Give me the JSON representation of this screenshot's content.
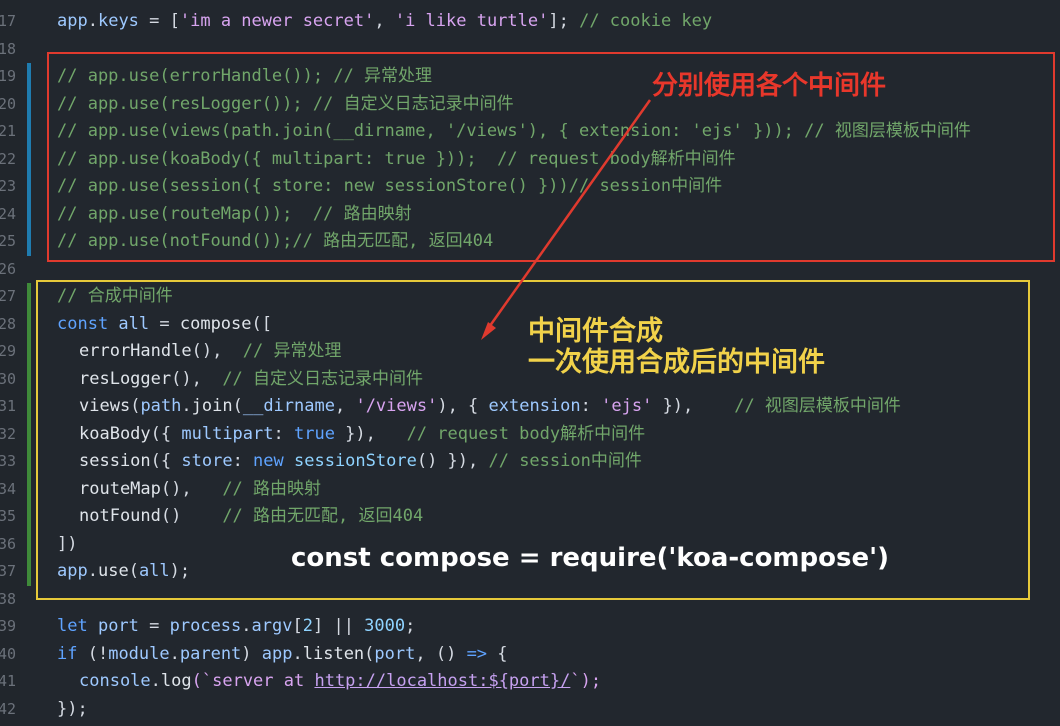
{
  "editor": {
    "lines": [
      {
        "num": "17",
        "tokens": [
          {
            "t": "app",
            "c": "v"
          },
          {
            "t": ".",
            "c": "p"
          },
          {
            "t": "keys",
            "c": "v"
          },
          {
            "t": " = [",
            "c": "p"
          },
          {
            "t": "'im a newer secret'",
            "c": "s"
          },
          {
            "t": ", ",
            "c": "p"
          },
          {
            "t": "'i like turtle'",
            "c": "s"
          },
          {
            "t": "]; ",
            "c": "p"
          },
          {
            "t": "// cookie key",
            "c": "c"
          }
        ]
      },
      {
        "num": "18",
        "tokens": []
      },
      {
        "num": "19",
        "mark": "blue",
        "tokens": [
          {
            "t": "// app.use(errorHandle()); // 异常处理",
            "c": "c"
          }
        ]
      },
      {
        "num": "20",
        "mark": "blue",
        "tokens": [
          {
            "t": "// app.use(resLogger()); // 自定义日志记录中间件",
            "c": "c"
          }
        ]
      },
      {
        "num": "21",
        "mark": "blue",
        "tokens": [
          {
            "t": "// app.use(views(path.join(__dirname, '/views'), { extension: 'ejs' })); // 视图层模板中间件",
            "c": "c"
          }
        ]
      },
      {
        "num": "22",
        "mark": "blue",
        "tokens": [
          {
            "t": "// app.use(koaBody({ multipart: true }));  // request body解析中间件",
            "c": "c"
          }
        ]
      },
      {
        "num": "23",
        "mark": "blue",
        "tokens": [
          {
            "t": "// app.use(session({ store: new sessionStore() }))// session中间件",
            "c": "c"
          }
        ]
      },
      {
        "num": "24",
        "mark": "blue",
        "tokens": [
          {
            "t": "// app.use(routeMap());  // 路由映射",
            "c": "c"
          }
        ]
      },
      {
        "num": "25",
        "mark": "blue",
        "tokens": [
          {
            "t": "// app.use(notFound());// 路由无匹配, 返回404",
            "c": "c"
          }
        ]
      },
      {
        "num": "26",
        "tokens": []
      },
      {
        "num": "27",
        "mark": "green",
        "tokens": [
          {
            "t": "// 合成中间件",
            "c": "c"
          }
        ]
      },
      {
        "num": "28",
        "mark": "green",
        "tokens": [
          {
            "t": "const ",
            "c": "k"
          },
          {
            "t": "all",
            "c": "v"
          },
          {
            "t": " = ",
            "c": "p"
          },
          {
            "t": "compose",
            "c": "f"
          },
          {
            "t": "([",
            "c": "p"
          }
        ]
      },
      {
        "num": "29",
        "mark": "green",
        "indent": true,
        "tokens": [
          {
            "t": "errorHandle",
            "c": "f"
          },
          {
            "t": "(),  ",
            "c": "p"
          },
          {
            "t": "// 异常处理",
            "c": "c"
          }
        ]
      },
      {
        "num": "30",
        "mark": "green",
        "indent": true,
        "tokens": [
          {
            "t": "resLogger",
            "c": "f"
          },
          {
            "t": "(),  ",
            "c": "p"
          },
          {
            "t": "// 自定义日志记录中间件",
            "c": "c"
          }
        ]
      },
      {
        "num": "31",
        "mark": "green",
        "indent": true,
        "tokens": [
          {
            "t": "views",
            "c": "f"
          },
          {
            "t": "(",
            "c": "p"
          },
          {
            "t": "path",
            "c": "v"
          },
          {
            "t": ".",
            "c": "p"
          },
          {
            "t": "join",
            "c": "f"
          },
          {
            "t": "(",
            "c": "p"
          },
          {
            "t": "__dirname",
            "c": "v"
          },
          {
            "t": ", ",
            "c": "p"
          },
          {
            "t": "'/views'",
            "c": "s"
          },
          {
            "t": "), { ",
            "c": "p"
          },
          {
            "t": "extension",
            "c": "v"
          },
          {
            "t": ": ",
            "c": "p"
          },
          {
            "t": "'ejs'",
            "c": "s"
          },
          {
            "t": " }),    ",
            "c": "p"
          },
          {
            "t": "// 视图层模板中间件",
            "c": "c"
          }
        ]
      },
      {
        "num": "32",
        "mark": "green",
        "indent": true,
        "tokens": [
          {
            "t": "koaBody",
            "c": "f"
          },
          {
            "t": "({ ",
            "c": "p"
          },
          {
            "t": "multipart",
            "c": "v"
          },
          {
            "t": ": ",
            "c": "p"
          },
          {
            "t": "true",
            "c": "k"
          },
          {
            "t": " }),   ",
            "c": "p"
          },
          {
            "t": "// request body解析中间件",
            "c": "c"
          }
        ]
      },
      {
        "num": "33",
        "mark": "green",
        "indent": true,
        "tokens": [
          {
            "t": "session",
            "c": "f"
          },
          {
            "t": "({ ",
            "c": "p"
          },
          {
            "t": "store",
            "c": "v"
          },
          {
            "t": ": ",
            "c": "p"
          },
          {
            "t": "new ",
            "c": "k"
          },
          {
            "t": "sessionStore",
            "c": "n"
          },
          {
            "t": "() }), ",
            "c": "p"
          },
          {
            "t": "// session中间件",
            "c": "c"
          }
        ]
      },
      {
        "num": "34",
        "mark": "green",
        "indent": true,
        "tokens": [
          {
            "t": "routeMap",
            "c": "f"
          },
          {
            "t": "(),   ",
            "c": "p"
          },
          {
            "t": "// 路由映射",
            "c": "c"
          }
        ]
      },
      {
        "num": "35",
        "mark": "green",
        "indent": true,
        "tokens": [
          {
            "t": "notFound",
            "c": "f"
          },
          {
            "t": "()    ",
            "c": "p"
          },
          {
            "t": "// 路由无匹配, 返回404",
            "c": "c"
          }
        ]
      },
      {
        "num": "36",
        "mark": "green",
        "tokens": [
          {
            "t": "])",
            "c": "p"
          }
        ]
      },
      {
        "num": "37",
        "mark": "green",
        "tokens": [
          {
            "t": "app",
            "c": "v"
          },
          {
            "t": ".",
            "c": "p"
          },
          {
            "t": "use",
            "c": "f"
          },
          {
            "t": "(",
            "c": "p"
          },
          {
            "t": "all",
            "c": "v"
          },
          {
            "t": ");",
            "c": "p"
          }
        ]
      },
      {
        "num": "38",
        "tokens": []
      },
      {
        "num": "39",
        "tokens": [
          {
            "t": "let ",
            "c": "k"
          },
          {
            "t": "port",
            "c": "v"
          },
          {
            "t": " = ",
            "c": "p"
          },
          {
            "t": "process",
            "c": "v"
          },
          {
            "t": ".",
            "c": "p"
          },
          {
            "t": "argv",
            "c": "v"
          },
          {
            "t": "[",
            "c": "p"
          },
          {
            "t": "2",
            "c": "n"
          },
          {
            "t": "] || ",
            "c": "p"
          },
          {
            "t": "3000",
            "c": "n"
          },
          {
            "t": ";",
            "c": "p"
          }
        ]
      },
      {
        "num": "40",
        "tokens": [
          {
            "t": "if ",
            "c": "k"
          },
          {
            "t": "(!",
            "c": "p"
          },
          {
            "t": "module",
            "c": "v"
          },
          {
            "t": ".",
            "c": "p"
          },
          {
            "t": "parent",
            "c": "v"
          },
          {
            "t": ") ",
            "c": "p"
          },
          {
            "t": "app",
            "c": "v"
          },
          {
            "t": ".",
            "c": "p"
          },
          {
            "t": "listen",
            "c": "f"
          },
          {
            "t": "(",
            "c": "p"
          },
          {
            "t": "port",
            "c": "v"
          },
          {
            "t": ", () ",
            "c": "p"
          },
          {
            "t": "=>",
            "c": "k"
          },
          {
            "t": " {",
            "c": "p"
          }
        ]
      },
      {
        "num": "41",
        "indent": true,
        "tokens": [
          {
            "t": "console",
            "c": "v"
          },
          {
            "t": ".",
            "c": "p"
          },
          {
            "t": "log",
            "c": "f"
          },
          {
            "t": "(`",
            "c": "s"
          },
          {
            "t": "server at ",
            "c": "s"
          },
          {
            "t": "http://localhost:${port}/",
            "c": "u"
          },
          {
            "t": "`);",
            "c": "s"
          }
        ]
      },
      {
        "num": "42",
        "tokens": [
          {
            "t": "});",
            "c": "p"
          }
        ]
      }
    ]
  },
  "annotations": {
    "red_note": "分别使用各个中间件",
    "yellow_note_line1": "中间件合成",
    "yellow_note_line2": "一次使用合成后的中间件",
    "require_note": "const compose = require('koa-compose')"
  },
  "colors": {
    "background": "#22272e",
    "red_box": "#e03a2e",
    "yellow_box": "#e6c93a",
    "comment": "#71a66a",
    "keyword": "#5fa3ff",
    "string": "#d8a4f0"
  }
}
